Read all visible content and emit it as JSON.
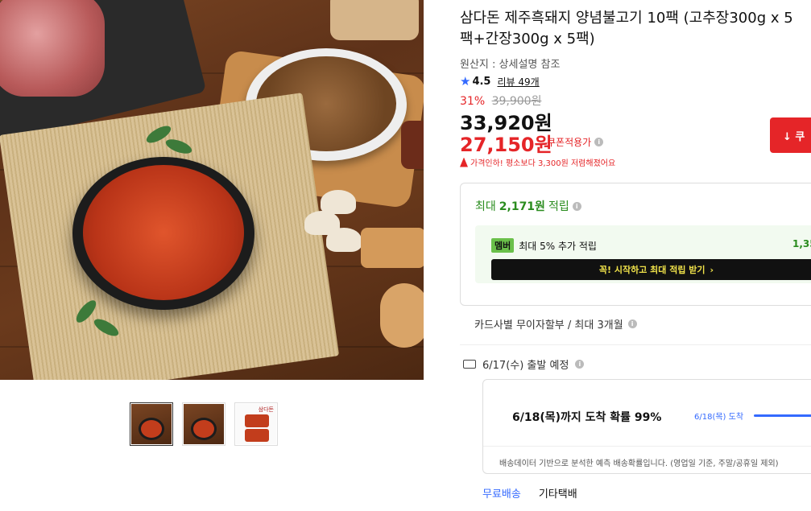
{
  "product": {
    "title": "삼다돈 제주흑돼지 양념불고기 10팩 (고추장300g x 5팩+간장300g x 5팩)",
    "origin": "원산지 : 상세설명 참조",
    "rating": "4.5",
    "review_link": "리뷰 49개",
    "discount_pct": "31%",
    "original_price": "39,900원",
    "price": "33,920원",
    "coupon_price": "27,150원",
    "coupon_label": "쿠폰적용가",
    "price_alert": "가격인하! 평소보다 3,300원 저렴해졌어요",
    "coupon_button": "↓ 쿠"
  },
  "reward": {
    "head_prefix": "최대",
    "head_amount": "2,171원",
    "head_suffix": "적립",
    "member_badge": "멤버",
    "member_text": "최대 5% 추가 적립",
    "member_amount": "1,35",
    "member_button": "꼭! 시작하고 최대 적립 받기",
    "member_button_arrow": "›"
  },
  "installment": "카드사별 무이자할부 / 최대 3개월",
  "shipping": {
    "departure": "6/17(수) 출발 예정",
    "probability": "6/18(목)까지 도착 확률 99%",
    "mini_label": "6/18(목) 도착",
    "note": "배송데이터 기반으로 분석한 예측 배송확률입니다. (영업일 기준, 주말/공휴일 제외)",
    "free_shipping": "무료배송",
    "carrier": "기타택배"
  },
  "thumbnails": {
    "third_logo": "삼다돈"
  },
  "colors": {
    "accent_red": "#e52528",
    "accent_blue": "#346aff",
    "accent_green": "#2a8c1e"
  }
}
